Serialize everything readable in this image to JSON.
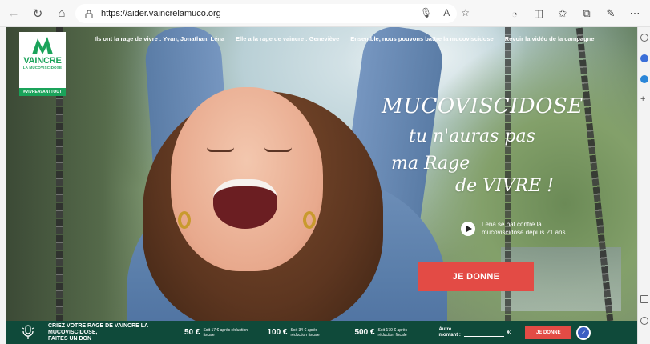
{
  "browser": {
    "url": "https://aider.vaincrelamuco.org"
  },
  "logo": {
    "word": "VAINCRE",
    "sub": "LA MUCOVISCIDOSE",
    "tag": "#VIVREAVANTTOUT"
  },
  "nav": {
    "item1_prefix": "Ils ont la rage de vivre :",
    "item1_name1": "Yvan",
    "item1_name2": "Jonathan",
    "item1_name3": "Léna",
    "item2": "Elle a la rage de vaincre : Geneviève",
    "item3": "Ensemble, nous pouvons battre la mucoviscidose",
    "item4": "Revoir la vidéo de la campagne"
  },
  "headline": {
    "line1": "MUCOVISCIDOSE",
    "line2": "tu n'auras pas",
    "line3": "ma Rage",
    "line4": "de VIVRE !"
  },
  "video": {
    "caption_line1": "Lena se bat contre la",
    "caption_line2": "mucoviscidose depuis 21 ans."
  },
  "cta": {
    "label": "JE DONNE"
  },
  "donation": {
    "title_line1": "CRIEZ VOTRE RAGE DE VAINCRE LA MUCOVISCIDOSE,",
    "title_line2": "FAITES UN DON",
    "amounts": [
      {
        "value": "50 €",
        "note_line1": "Soit 17 € après réduction",
        "note_line2": "fiscale"
      },
      {
        "value": "100 €",
        "note_line1": "Soit 34 € après",
        "note_line2": "réduction fiscale"
      },
      {
        "value": "500 €",
        "note_line1": "Soit 170 € après",
        "note_line2": "réduction fiscale"
      }
    ],
    "other_line1": "Autre",
    "other_line2": "montant :",
    "other_currency": "€",
    "button": "JE DONNE"
  }
}
